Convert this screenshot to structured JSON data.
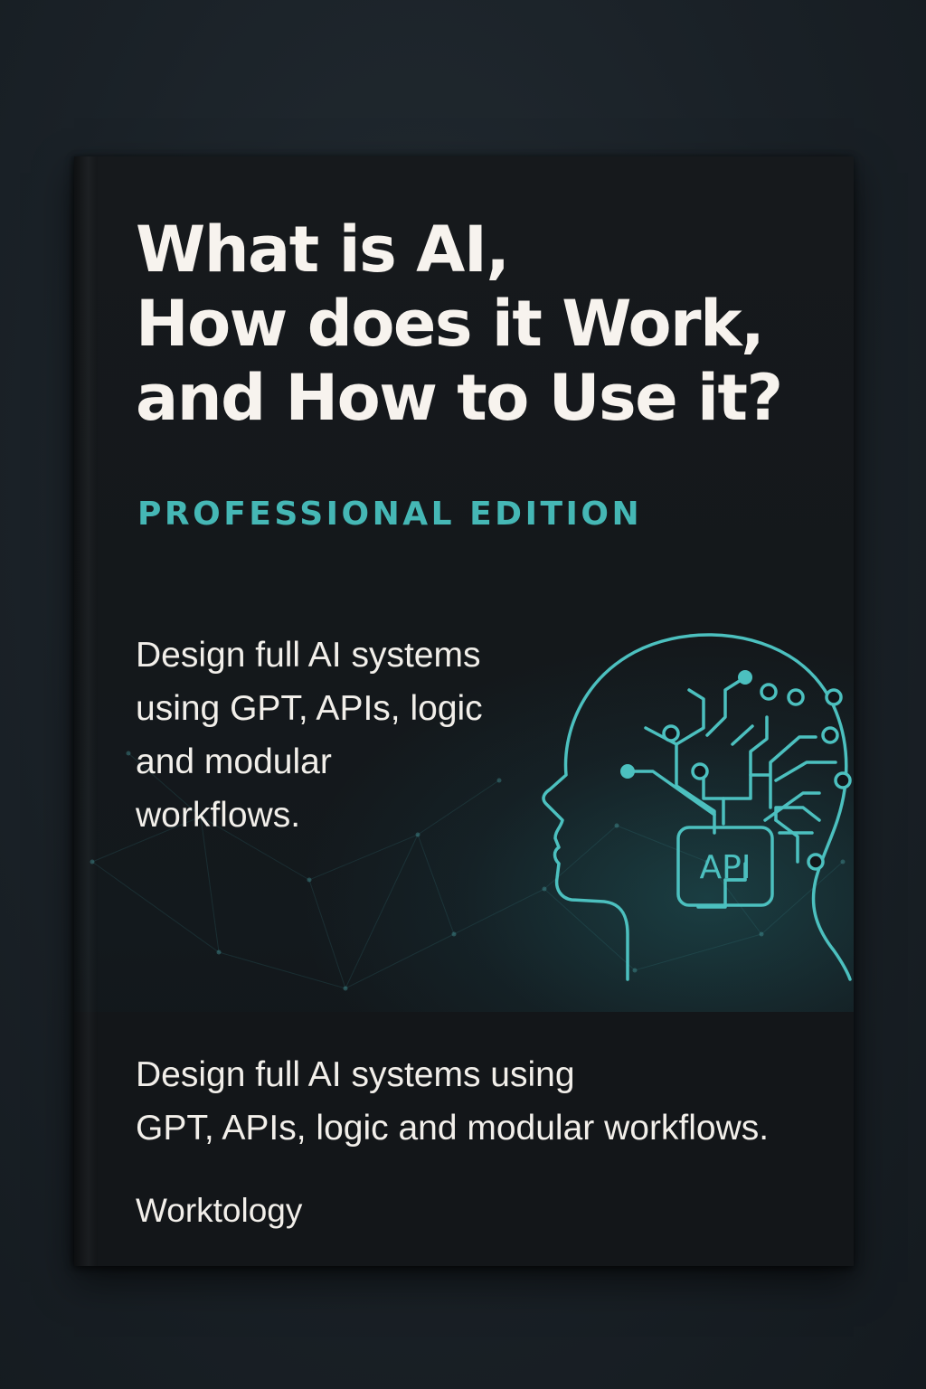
{
  "book": {
    "title_lines": [
      "What is AI,",
      "How does it Work,",
      "and How to Use it?"
    ],
    "edition": "PROFESSIONAL EDITION",
    "blurb": "Design full AI systems\nusing GPT, APIs, logic\nand modular\nworkflows.",
    "illustration": {
      "icon": "head-circuit-icon",
      "chip_label": "API"
    },
    "tagline": "Design full AI systems using\nGPT, APIs, logic and modular workflows.",
    "publisher": "Worktology"
  },
  "colors": {
    "background": "#1b2228",
    "cover": "#15191c",
    "title": "#f7f3ee",
    "accent": "#45b7b5",
    "body_text": "#f2efea"
  }
}
